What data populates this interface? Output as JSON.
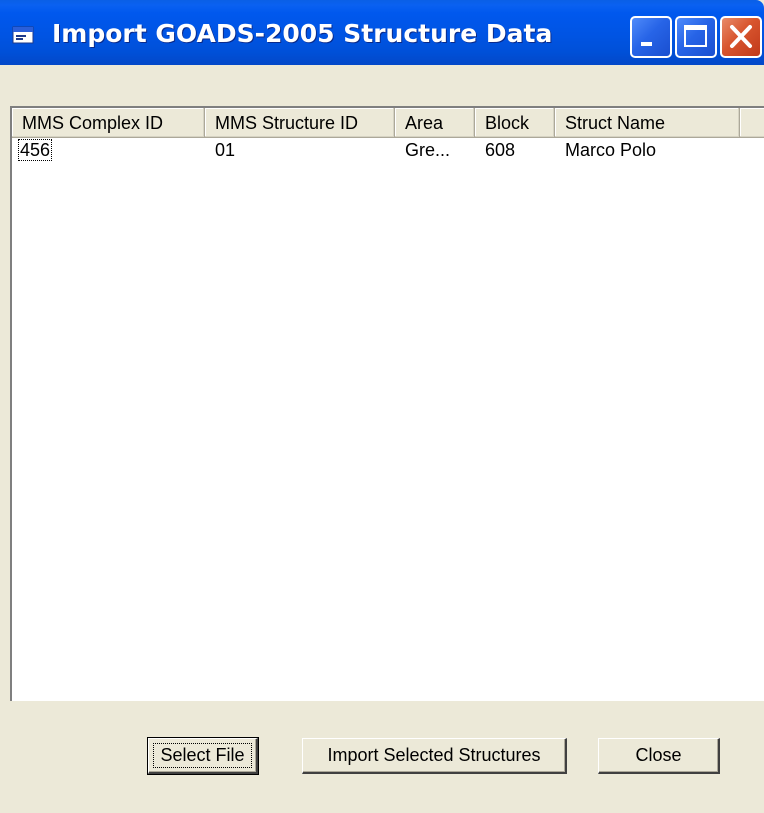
{
  "window": {
    "title": "Import GOADS-2005 Structure Data",
    "icon": "app-window-icon",
    "titlebar_color": "#0054E3"
  },
  "titlebar_buttons": {
    "minimize": "minimize-icon",
    "maximize": "maximize-icon",
    "close": "close-icon"
  },
  "list": {
    "columns": [
      "MMS Complex ID",
      "MMS Structure ID",
      "Area",
      "Block",
      "Struct Name",
      ""
    ],
    "rows": [
      {
        "complex_id": "456",
        "structure_id": "01",
        "area": "Gre...",
        "block": "608",
        "struct_name": "Marco Polo"
      }
    ]
  },
  "buttons": {
    "select_file": "Select File",
    "import_selected": "Import Selected Structures",
    "close": "Close"
  }
}
